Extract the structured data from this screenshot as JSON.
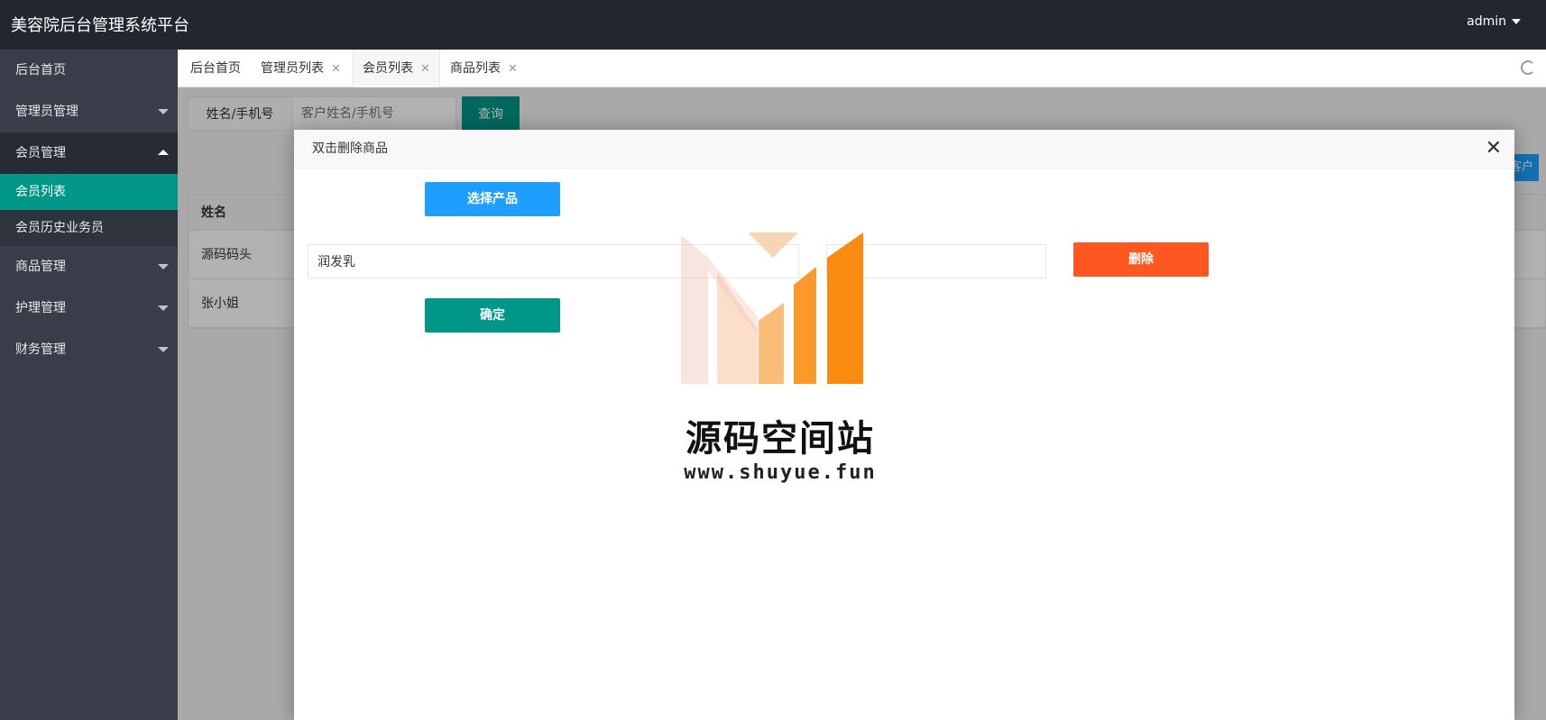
{
  "header": {
    "app_title": "美容院后台管理系统平台",
    "user": "admin"
  },
  "sidebar": {
    "items": [
      {
        "label": "后台首页"
      },
      {
        "label": "管理员管理"
      },
      {
        "label": "会员管理"
      },
      {
        "label": "会员列表"
      },
      {
        "label": "会员历史业务员"
      },
      {
        "label": "商品管理"
      },
      {
        "label": "护理管理"
      },
      {
        "label": "财务管理"
      }
    ]
  },
  "tabs": [
    {
      "label": "后台首页"
    },
    {
      "label": "管理员列表",
      "close": "✕"
    },
    {
      "label": "会员列表",
      "close": "✕"
    },
    {
      "label": "商品列表",
      "close": "✕"
    }
  ],
  "search": {
    "label": "姓名/手机号",
    "placeholder": "客户姓名/手机号",
    "button": "查询"
  },
  "right_button": "客户",
  "table": {
    "header": "姓名",
    "rows": [
      "源码码头",
      "张小姐"
    ]
  },
  "modal": {
    "title": "双击删除商品",
    "close_icon": "✕",
    "select_button": "选择产品",
    "product_value": "润发乳",
    "delete_button": "删除",
    "confirm_button": "确定"
  },
  "watermark": {
    "name": "源码空间站",
    "url": "www.shuyue.fun"
  }
}
